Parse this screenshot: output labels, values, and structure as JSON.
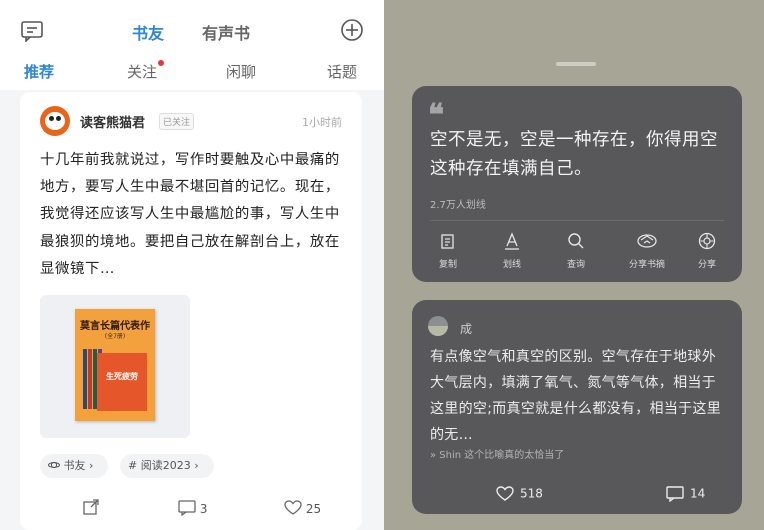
{
  "top_tabs": [
    "书友",
    "有声书"
  ],
  "sub_tabs": [
    "推荐",
    "关注",
    "闲聊",
    "话题"
  ],
  "post": {
    "username": "读客熊猫君",
    "follow_badge": "已关注",
    "time": "1小时前",
    "text": "十几年前我就说过，写作时要触及心中最痛的地方，要写人生中最不堪回首的记忆。现在，我觉得还应该写人生中最尴尬的事，写人生中最狼狈的境地。要把自己放在解剖台上，放在显微镜下…",
    "book_title": "莫言长篇代表作",
    "book_subtitle": "(全7册)",
    "book_inner": "生死疲劳",
    "tags": [
      "书友",
      "# 阅读2023"
    ],
    "comment_count": "3",
    "like_count": "25"
  },
  "quote_panel": {
    "quote": "空不是无，空是一种存在，你得用空这种存在填满自己。",
    "mark_count": "2.7万人划线",
    "actions": [
      "复制",
      "划线",
      "查询",
      "分享书摘",
      "分享"
    ]
  },
  "comment_panel": {
    "name": "成",
    "text": "有点像空气和真空的区别。空气存在于地球外大气层内，填满了氧气、氮气等气体，相当于这里的空;而真空就是什么都没有，相当于这里的无…",
    "reply": "» Shin 这个比喻真的太恰当了",
    "like_count": "518",
    "comment_count": "14"
  },
  "colors": {
    "accent": "#2f86d6",
    "notify_dot": "#e33333",
    "right_bg": "#a7a595",
    "panel_bg": "#58575a",
    "book_cover": "#f3a13c"
  },
  "icons": [
    "message-icon",
    "plus-circle-icon",
    "share-out-icon",
    "comment-icon",
    "heart-icon",
    "copy-icon",
    "underline-icon",
    "search-icon",
    "share-note-icon",
    "share-icon"
  ]
}
